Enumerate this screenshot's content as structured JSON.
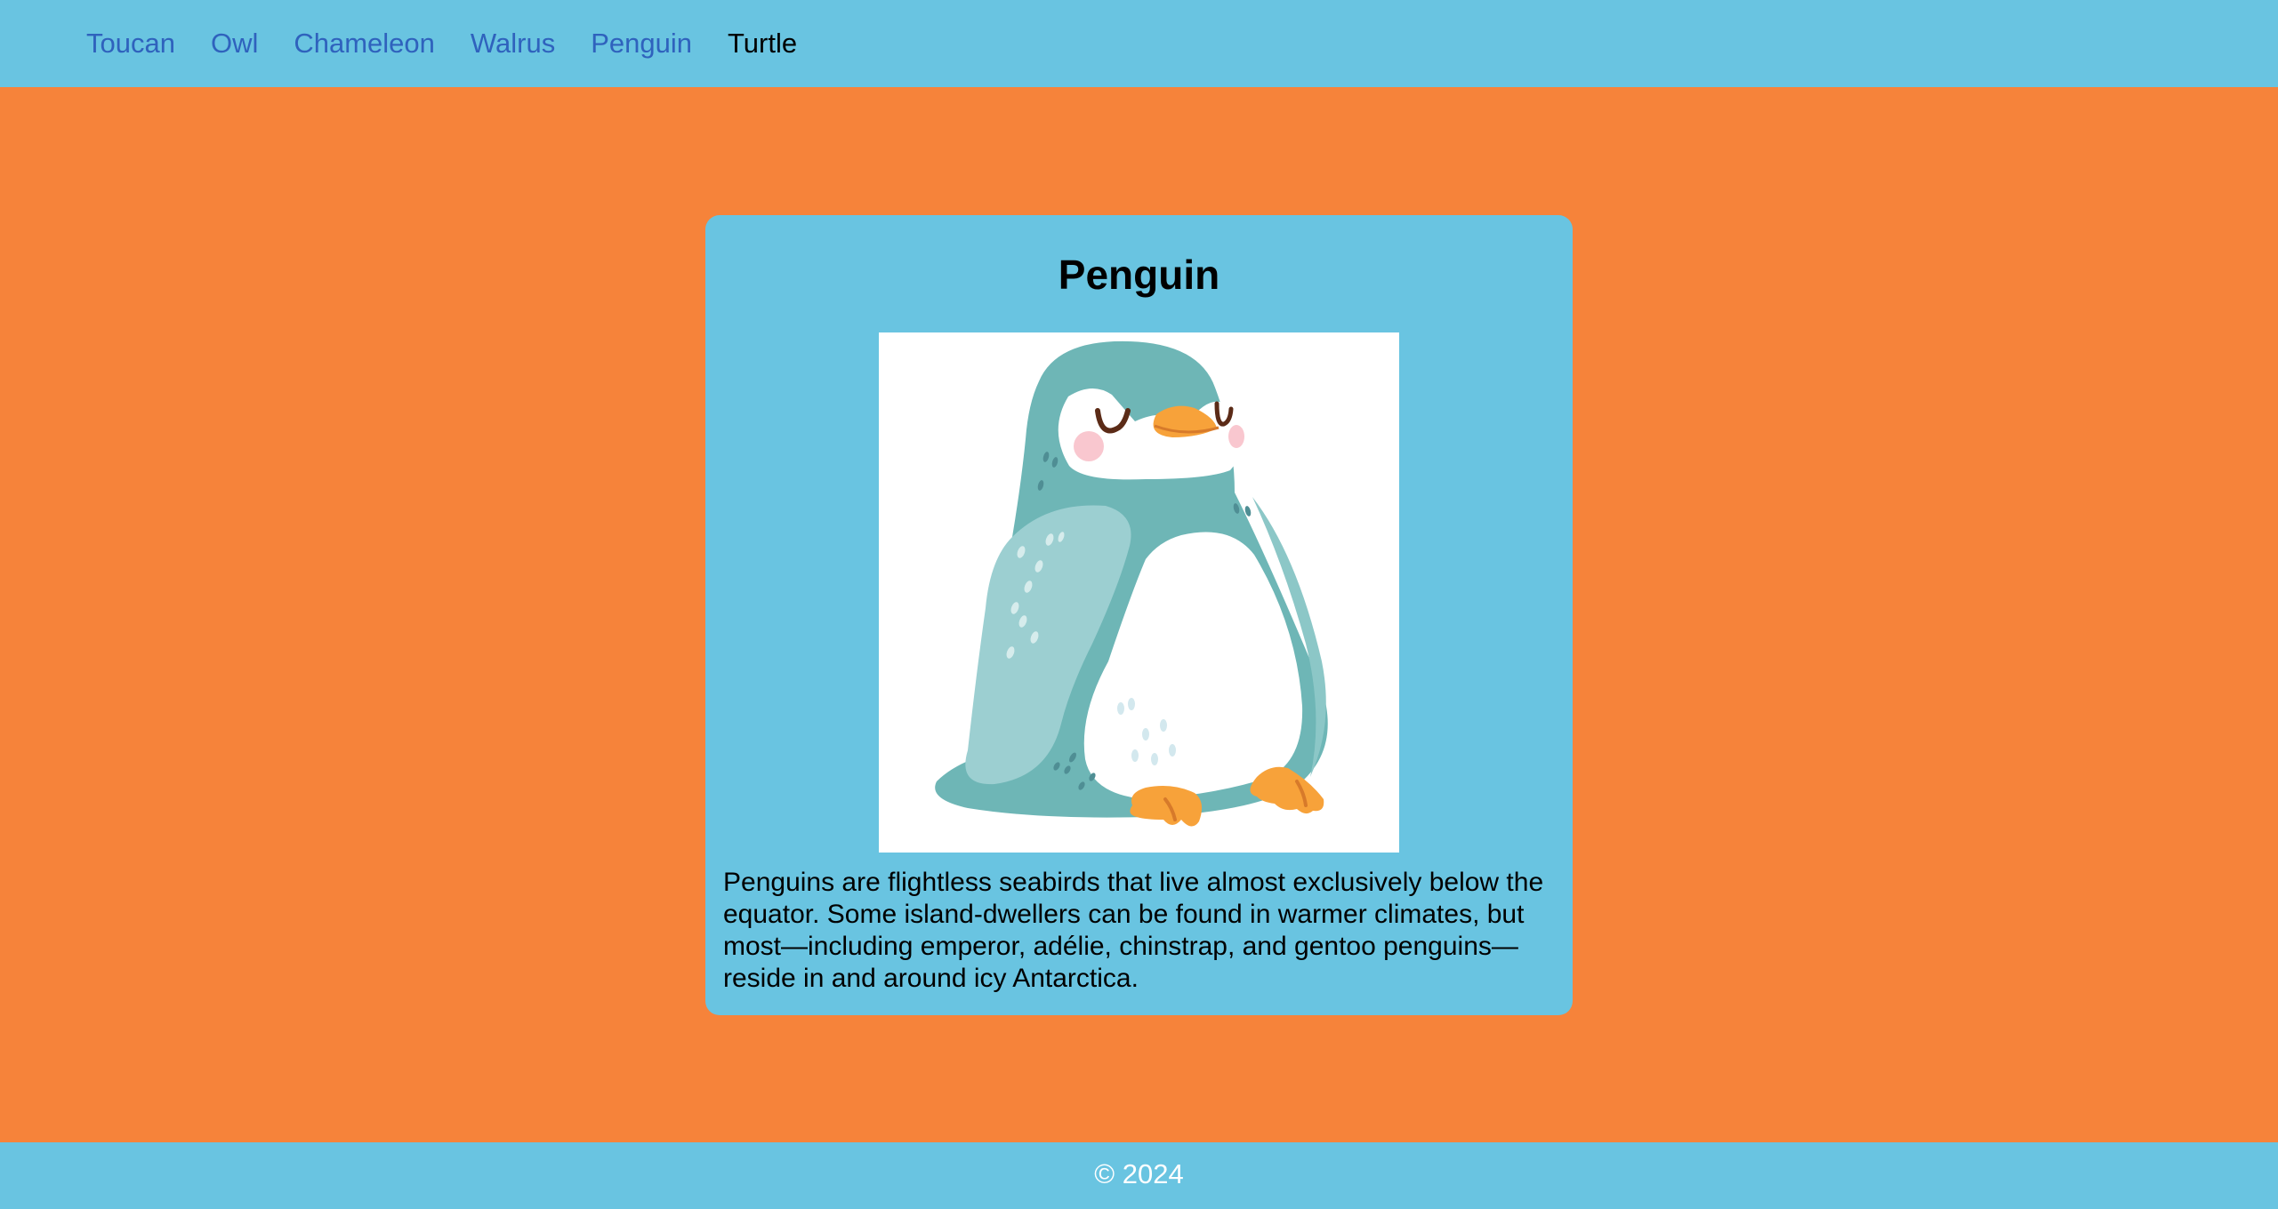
{
  "nav": {
    "items": [
      {
        "label": "Toucan",
        "link": true
      },
      {
        "label": "Owl",
        "link": true
      },
      {
        "label": "Chameleon",
        "link": true
      },
      {
        "label": "Walrus",
        "link": true
      },
      {
        "label": "Penguin",
        "link": true
      },
      {
        "label": "Turtle",
        "link": false
      }
    ]
  },
  "card": {
    "title": "Penguin",
    "image_subject": "penguin-illustration",
    "description": "Penguins are flightless seabirds that live almost exclusively below the equator. Some island-dwellers can be found in warmer climates, but most—including emperor, adélie, chinstrap, and gentoo penguins—reside in and around icy Antarctica."
  },
  "footer": {
    "copyright": "© 2024"
  },
  "colors": {
    "page_background": "#f6833a",
    "bar_background": "#69c4e1",
    "link": "#2f62bd",
    "penguin_body": "#6eb6b6",
    "penguin_wing": "#9ccfd1",
    "penguin_beak": "#f7a23a"
  }
}
